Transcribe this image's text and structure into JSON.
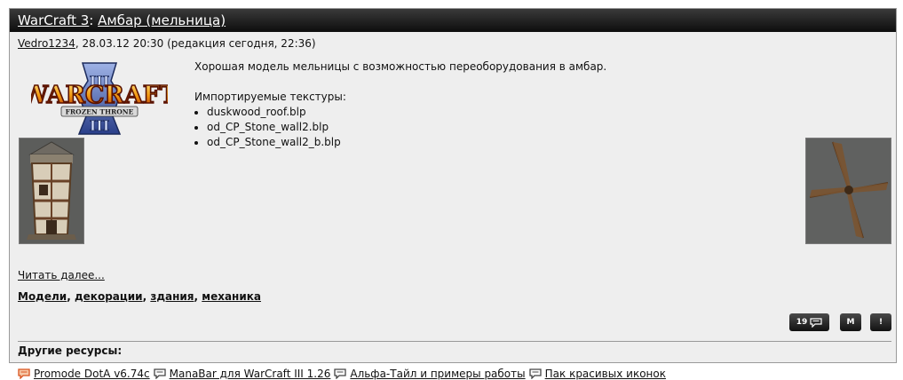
{
  "header": {
    "category": "WarCraft 3",
    "separator": ":",
    "title": "Амбар (мельница)"
  },
  "meta": {
    "author": "Vedro1234",
    "date_text": ", 28.03.12 20:30 (редакция сегодня, 22:36)"
  },
  "logo": {
    "alt": "WarCraft III The Frozen Throne",
    "text_main": "WARCRAFT",
    "text_sub": "FROZEN THRONE"
  },
  "description": {
    "intro": "Хорошая модель мельницы с возможностью переоборудования в амбар.",
    "textures_heading": "Импортируемые текстуры:",
    "textures": [
      "duskwood_roof.blp",
      "od_CP_Stone_wall2.blp",
      "od_CP_Stone_wall2_b.blp"
    ]
  },
  "read_more": "Читать далее...",
  "tags": {
    "items": [
      "Модели",
      "декорации",
      "здания",
      "механика"
    ],
    "separator": ", "
  },
  "buttons": {
    "comments_count": "19",
    "m_label": "M",
    "excl_label": "!"
  },
  "other": {
    "title": "Другие ресурсы:",
    "items": [
      {
        "label": "Promode DotA v6.74c",
        "icon": "comment-icon",
        "color": "#d9531e"
      },
      {
        "label": "ManaBar для WarCraft III 1.26",
        "icon": "comment-icon",
        "color": "#444444"
      },
      {
        "label": "Альфа-Тайл и примеры работы",
        "icon": "comment-icon",
        "color": "#444444"
      },
      {
        "label": "Пак красивых иконок",
        "icon": "comment-icon",
        "color": "#444444"
      }
    ]
  },
  "colors": {
    "titlebar": "#111111",
    "panel": "#eeeeee",
    "first_icon": "#d9531e"
  }
}
